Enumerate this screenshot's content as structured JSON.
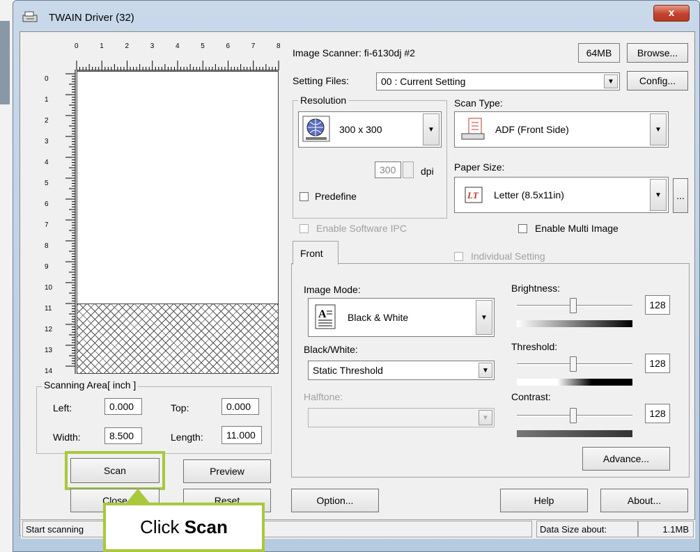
{
  "window": {
    "title": "TWAIN Driver (32)",
    "close_label": "x"
  },
  "scanner": {
    "label": "Image Scanner:",
    "name": "fi-6130dj #2",
    "memory": "64MB",
    "browse_label": "Browse..."
  },
  "settings": {
    "label": "Setting Files:",
    "value": "00 : Current Setting",
    "config_label": "Config..."
  },
  "ruler": {
    "top_numbers": [
      "0",
      "1",
      "2",
      "3",
      "4",
      "5",
      "6",
      "7",
      "8"
    ],
    "left_numbers": [
      "0",
      "1",
      "2",
      "3",
      "4",
      "5",
      "6",
      "7",
      "8",
      "9",
      "10",
      "11",
      "12",
      "13",
      "14"
    ]
  },
  "resolution": {
    "group_label": "Resolution",
    "value": "300 x 300",
    "custom_value": "300",
    "unit": "dpi",
    "predefine_label": "Predefine"
  },
  "scan_type": {
    "label": "Scan Type:",
    "value": "ADF (Front Side)"
  },
  "paper_size": {
    "label": "Paper Size:",
    "value": "Letter (8.5x11in)",
    "more_label": "..."
  },
  "options": {
    "enable_ipc_label": "Enable Software IPC",
    "multi_image_label": "Enable Multi Image",
    "individual_label": "Individual Setting"
  },
  "tab": {
    "front_label": "Front"
  },
  "image_mode": {
    "label": "Image Mode:",
    "value": "Black & White"
  },
  "bw": {
    "label": "Black/White:",
    "value": "Static Threshold"
  },
  "halftone": {
    "label": "Halftone:"
  },
  "brightness": {
    "label": "Brightness:",
    "value": "128"
  },
  "threshold": {
    "label": "Threshold:",
    "value": "128"
  },
  "contrast": {
    "label": "Contrast:",
    "value": "128"
  },
  "advance_label": "Advance...",
  "scan_area": {
    "group_label": "Scanning Area[ inch ]",
    "left_label": "Left:",
    "left_value": "0.000",
    "top_label": "Top:",
    "top_value": "0.000",
    "width_label": "Width:",
    "width_value": "8.500",
    "length_label": "Length:",
    "length_value": "11.000"
  },
  "buttons": {
    "scan": "Scan",
    "preview": "Preview",
    "close": "Close",
    "reset": "Reset",
    "option": "Option...",
    "help": "Help",
    "about": "About..."
  },
  "status": {
    "message": "Start scanning",
    "data_label": "Data Size about:",
    "data_value": "1.1MB"
  },
  "callout": {
    "prefix": "Click ",
    "bold": "Scan",
    "color": "#a9c83c"
  }
}
